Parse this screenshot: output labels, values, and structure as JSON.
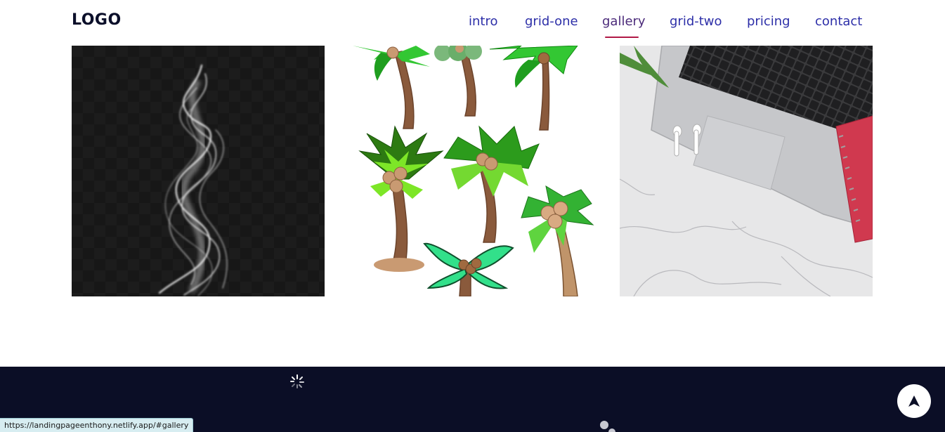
{
  "header": {
    "logo": "LOGO",
    "nav": [
      {
        "label": "intro"
      },
      {
        "label": "grid-one"
      },
      {
        "label": "gallery"
      },
      {
        "label": "grid-two"
      },
      {
        "label": "pricing"
      },
      {
        "label": "contact"
      }
    ],
    "active_nav": "gallery"
  },
  "gallery": {
    "images": [
      {
        "name": "smoke-image",
        "subject": "white smoke on dark background"
      },
      {
        "name": "palm-trees-image",
        "subject": "cartoon palm trees"
      },
      {
        "name": "laptop-image",
        "subject": "laptop with earbuds and notebook on marble"
      }
    ]
  },
  "footer": {
    "scroll_top_icon": "arrow-up-icon",
    "loading_icon": "spinner-icon"
  },
  "status_bar": {
    "url": "https://landingpageenthony.netlify.app/#gallery"
  },
  "colors": {
    "nav_link": "#2d2fa8",
    "active_underline": "#b01846",
    "footer_bg": "#0b0e26",
    "logo": "#0b0f2a"
  }
}
